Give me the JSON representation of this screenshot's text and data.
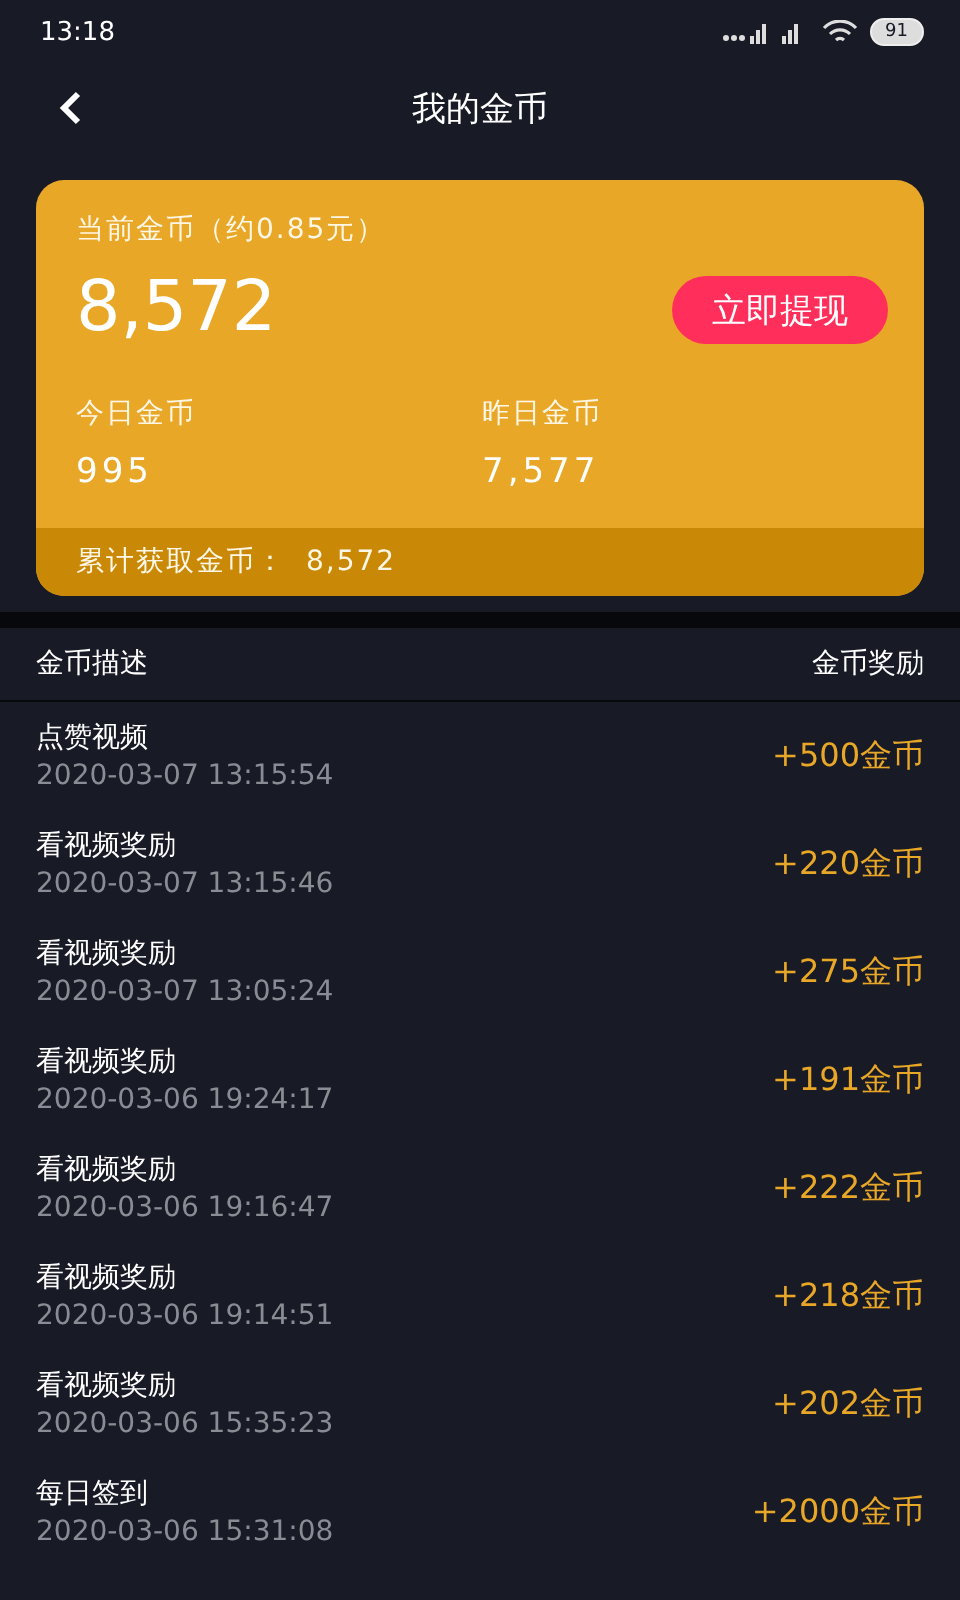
{
  "status_bar": {
    "time": "13:18",
    "battery": "91"
  },
  "header": {
    "title": "我的金币"
  },
  "card": {
    "current_label": "当前金币（约0.85元）",
    "current_value": "8,572",
    "withdraw_button": "立即提现",
    "stats": [
      {
        "label": "今日金币",
        "value": "995"
      },
      {
        "label": "昨日金币",
        "value": "7,577"
      }
    ],
    "total_label": "累计获取金币：",
    "total_value": "8,572"
  },
  "table": {
    "columns": [
      "金币描述",
      "金币奖励"
    ],
    "rows": [
      {
        "title": "点赞视频",
        "time": "2020-03-07 13:15:54",
        "reward": "+500金币"
      },
      {
        "title": "看视频奖励",
        "time": "2020-03-07 13:15:46",
        "reward": "+220金币"
      },
      {
        "title": "看视频奖励",
        "time": "2020-03-07 13:05:24",
        "reward": "+275金币"
      },
      {
        "title": "看视频奖励",
        "time": "2020-03-06 19:24:17",
        "reward": "+191金币"
      },
      {
        "title": "看视频奖励",
        "time": "2020-03-06 19:16:47",
        "reward": "+222金币"
      },
      {
        "title": "看视频奖励",
        "time": "2020-03-06 19:14:51",
        "reward": "+218金币"
      },
      {
        "title": "看视频奖励",
        "time": "2020-03-06 15:35:23",
        "reward": "+202金币"
      },
      {
        "title": "每日签到",
        "time": "2020-03-06 15:31:08",
        "reward": "+2000金币"
      }
    ]
  }
}
